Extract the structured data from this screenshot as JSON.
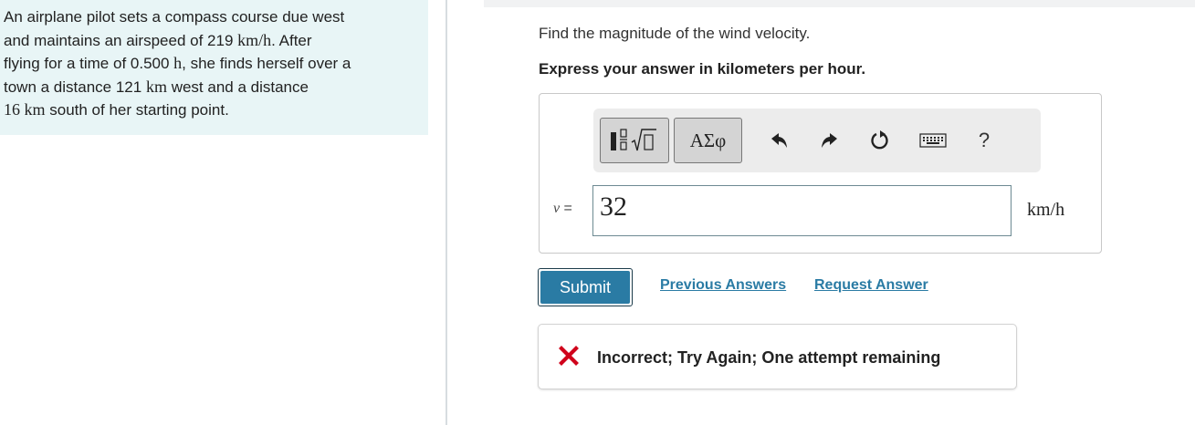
{
  "problem": {
    "l1": "An airplane pilot sets a compass course due west",
    "l2a": "and maintains an airspeed of 219 ",
    "l2m": "km/h",
    "l2b": ". After",
    "l3a": "flying for a time of 0.500 ",
    "l3m": "h",
    "l3b": ", she finds herself over a",
    "l4a": "town a distance 121 ",
    "l4m": "km",
    "l4b": " west and a distance",
    "l5m": "16 km",
    "l5b": " south of her starting point."
  },
  "question": "Find the magnitude of the wind velocity.",
  "instruction": "Express your answer in kilometers per hour.",
  "toolbar": {
    "greek_label": "ΑΣφ",
    "help_label": "?",
    "icons": [
      "template-icon",
      "undo-icon",
      "redo-icon",
      "reset-icon",
      "keyboard-icon",
      "help-icon"
    ]
  },
  "answer": {
    "variable": "v",
    "equals": " =",
    "value": "32",
    "unit": "km/h"
  },
  "submit_label": "Submit",
  "links": {
    "previous": "Previous Answers",
    "request": "Request Answer"
  },
  "feedback": {
    "text": "Incorrect; Try Again; One attempt remaining",
    "color": "#d0021b"
  },
  "colors": {
    "accent": "#2a7ba4",
    "problem_bg": "#e8f5f6"
  }
}
